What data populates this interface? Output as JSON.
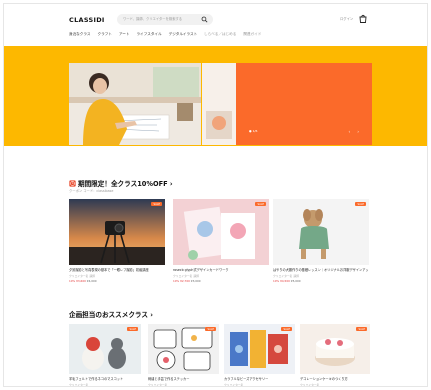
{
  "header": {
    "logo": "CLASSIDI",
    "search_placeholder": "ワード、講師、クリエイターを検索する",
    "login": "ログイン"
  },
  "nav": {
    "items": [
      "身近なクラス",
      "クラフト",
      "アート",
      "ライフスタイル",
      "デジタルイラスト"
    ],
    "extra": [
      "しらべる／はじめる",
      "関連ガイド"
    ]
  },
  "hero": {
    "bg_color": "#fdb800",
    "card_color": "#fb6a2a",
    "dots": "● 1/6",
    "arrows": "‹ ›"
  },
  "section1": {
    "title": "期間限定！全クラス10%OFF",
    "subtitle": "クーポン コード：classibase",
    "cards": [
      {
        "badge": "SALE",
        "title": "夕景撮影と写真表現の基本で「一眼レフ撮影」初級講座",
        "meta": "クリエイター名 講師",
        "price": "¥4,000",
        "sale": "10% ¥3,600"
      },
      {
        "badge": "SALE",
        "title": "rosecb glyph式デザインカードワーク",
        "meta": "クリエイター名 講師",
        "price": "¥3,000",
        "sale": "10% ¥2,700"
      },
      {
        "badge": "SALE",
        "title": "はやりの犬服作りの基礎レッスン｜オリジナルお洋服デザインアップ",
        "meta": "クリエイター名 講師",
        "price": "¥5,000",
        "sale": "10% ¥4,500"
      }
    ]
  },
  "section2": {
    "title": "企画担当のおススメクラス",
    "cards": [
      {
        "badge": "SALE",
        "title": "羊毛フェルトで作るネコのマスコット",
        "meta": "クリエイター名"
      },
      {
        "badge": "SALE",
        "title": "刺繍と手芸で作るステッカー",
        "meta": "クリエイター名"
      },
      {
        "badge": "SALE",
        "title": "カラフルなビーズアクセサリー",
        "meta": "クリエイター名"
      },
      {
        "badge": "SALE",
        "title": "デコレーションケーキのつくり方",
        "meta": "クリエイター名"
      }
    ]
  }
}
